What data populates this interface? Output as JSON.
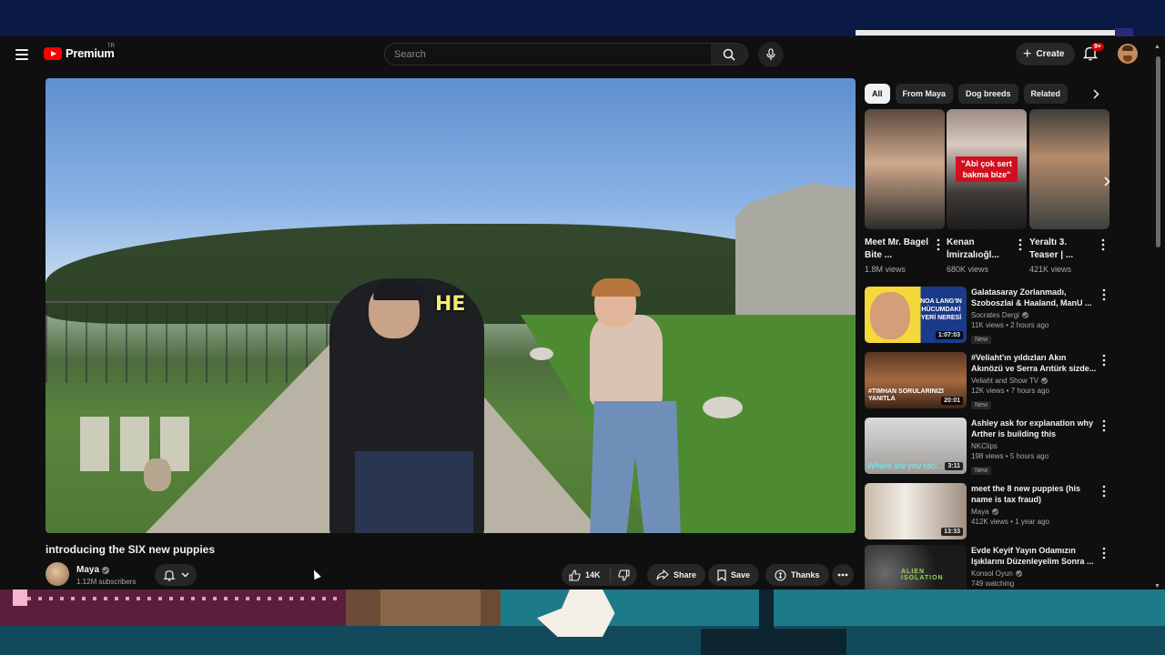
{
  "masthead": {
    "logo_text": "Premium",
    "region": "TR",
    "search_placeholder": "Search",
    "create_label": "Create",
    "notification_count": "9+"
  },
  "video": {
    "caption_overlay": "HE",
    "title": "introducing the SIX new puppies",
    "channel_name": "Maya",
    "subscribers": "1.12M subscribers",
    "likes": "14K",
    "share_label": "Share",
    "save_label": "Save",
    "thanks_label": "Thanks"
  },
  "chips": [
    "All",
    "From Maya",
    "Dog breeds",
    "Related"
  ],
  "shorts": [
    {
      "title": "Meet Mr. Bagel Bite ...",
      "views": "1.8M views"
    },
    {
      "title": "Kenan İmirzalıoğl...",
      "views": "680K views",
      "overlay": "\"Abi çok sert bakma bize\""
    },
    {
      "title": "Yeraltı 3. Teaser | ...",
      "views": "421K views"
    }
  ],
  "recommendations": [
    {
      "title": "Galatasaray Zorlanmadı, Szoboszlai & Haaland, ManU ...",
      "channel": "Socrates Dergi",
      "meta": "11K views • 2 hours ago",
      "badge": "New",
      "duration": "1:07:03",
      "thumb_text": "NOA LANG'IN HÜCUMDAKİ YERİ NERESİ"
    },
    {
      "title": "#Veliaht'ın yıldızları Akın Akınözü ve Serra Arıtürk sizde...",
      "channel": "Veliaht and Show TV",
      "meta": "12K views • 7 hours ago",
      "badge": "New",
      "duration": "20:01",
      "thumb_text": "#TIMHAN SORULARINIZI YANITLA"
    },
    {
      "title": "Ashley ask for explanation why Arther is building this",
      "channel": "NKClips",
      "meta": "198 views • 5 hours ago",
      "badge": "New",
      "duration": "3:11",
      "thumb_text": "Where are you raci..."
    },
    {
      "title": "meet the 8 new puppies (his name is tax fraud)",
      "channel": "Maya",
      "meta": "412K views • 1 year ago",
      "badge": "",
      "duration": "13:33",
      "thumb_text": ""
    },
    {
      "title": "Evde Keyif Yayın Odamızın Işıklarını Düzenleyelim Sonra ...",
      "channel": "Konsol Oyun",
      "meta": "749 watching",
      "badge": "",
      "duration": "",
      "thumb_text": "ALIEN ISOLATION"
    }
  ]
}
